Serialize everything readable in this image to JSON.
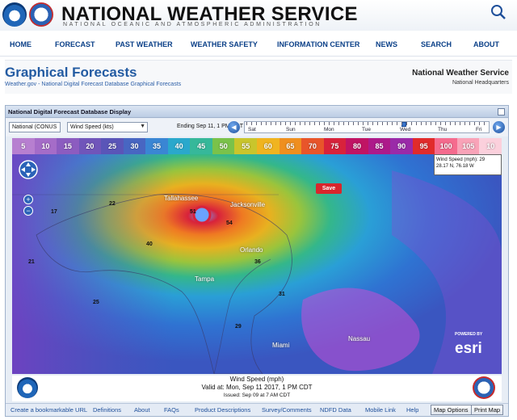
{
  "header": {
    "title": "NATIONAL WEATHER SERVICE",
    "subtitle": "NATIONAL OCEANIC AND ATMOSPHERIC ADMINISTRATION"
  },
  "nav": {
    "items": [
      "HOME",
      "FORECAST",
      "PAST WEATHER",
      "WEATHER SAFETY",
      "INFORMATION CENTER",
      "NEWS",
      "SEARCH",
      "ABOUT"
    ]
  },
  "page": {
    "title": "Graphical Forecasts",
    "breadcrumb": "Weather.gov - National Digital Forecast Database Graphical Forecasts",
    "org_name": "National Weather Service",
    "org_sub": "National Headquarters"
  },
  "panel": {
    "title": "National Digital Forecast Database Display",
    "region_select": "National (CONUS",
    "element_select": "Wind Speed (kts)",
    "ending_label": "Ending Sep 11,   1 PM CDT",
    "timeline_days": [
      "Sat",
      "Sun",
      "Mon",
      "Tue",
      "Wed",
      "Thu",
      "Fri"
    ],
    "time_position": 0.66
  },
  "map": {
    "scale_values": [
      "5",
      "10",
      "15",
      "20",
      "25",
      "30",
      "35",
      "40",
      "45",
      "50",
      "55",
      "60",
      "65",
      "70",
      "75",
      "80",
      "85",
      "90",
      "95",
      "100",
      "105",
      "10"
    ],
    "scale_colors": [
      "#b77fd0",
      "#a56cc8",
      "#8c5cc0",
      "#7055ba",
      "#5a55b8",
      "#4866c2",
      "#3a86d4",
      "#2aa8cc",
      "#36b89a",
      "#7ac24a",
      "#c9c52c",
      "#f0b420",
      "#ef8f1f",
      "#e8552a",
      "#d8223b",
      "#c01464",
      "#ad1a8a",
      "#9a2aa8",
      "#e12b2b",
      "#f56b8e",
      "#f9a3b8",
      "#fbd0dc"
    ],
    "save_label": "Save",
    "probe_text": "Wind Speed (mph): 29",
    "probe_coords": "28.17 N, 76.18 W",
    "place_labels": [
      "Tallahassee",
      "Jacksonville",
      "Orlando",
      "Tampa",
      "Miami",
      "Nassau"
    ],
    "esri_powered": "POWERED BY",
    "esri_word": "esri"
  },
  "caption": {
    "title": "Wind Speed (mph)",
    "valid": "Valid at: Mon, Sep 11 2017,     1 PM CDT",
    "issued": "Issued: Sep 09 at 7 AM CDT"
  },
  "footer": {
    "links": [
      "Create a bookmarkable URL",
      "Definitions",
      "About",
      "FAQs",
      "Product Descriptions",
      "Survey/Comments",
      "NDFD Data",
      "Mobile Link",
      "Help"
    ],
    "buttons": [
      "Map Options",
      "Print Map"
    ]
  }
}
